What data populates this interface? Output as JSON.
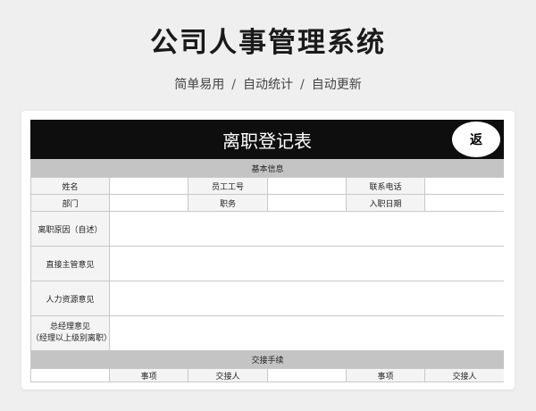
{
  "page": {
    "title": "公司人事管理系统",
    "subtitle_parts": [
      "简单易用",
      "自动统计",
      "自动更新"
    ],
    "subtitle_sep": "/"
  },
  "sheet": {
    "title": "离职登记表",
    "back_label": "返"
  },
  "form": {
    "basic_section": "基本信息",
    "name_label": "姓名",
    "emp_id_label": "员工工号",
    "phone_label": "联系电话",
    "dept_label": "部门",
    "position_label": "职务",
    "join_date_label": "入职日期",
    "reason_label": "离职原因（自述）",
    "supervisor_label": "直接主管意见",
    "hr_label": "人力资源意见",
    "gm_label_line1": "总经理意见",
    "gm_label_line2": "（经理以上级别离职）",
    "handover_section": "交接手续",
    "handover_item_label": "事项",
    "handover_person_label": "交接人"
  },
  "colors": {
    "page_bg": "#efefef",
    "header_bg": "#0e0e0e",
    "section_bg": "#c4c4c4"
  }
}
